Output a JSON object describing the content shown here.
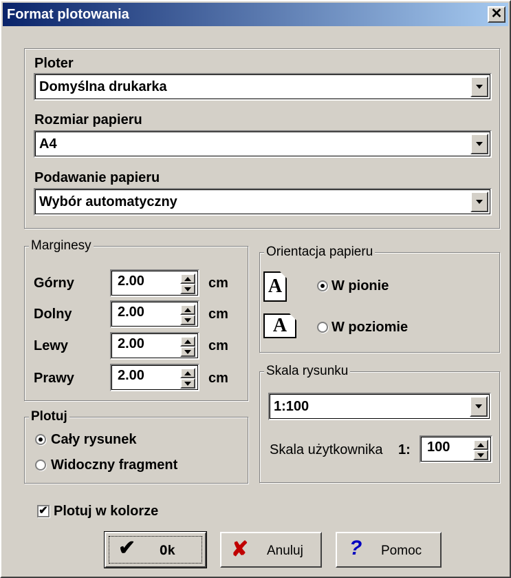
{
  "window": {
    "title": "Format plotowania",
    "close_label": "✕"
  },
  "plotter": {
    "ploter_label": "Ploter",
    "ploter_value": "Domyślna drukarka",
    "size_label": "Rozmiar papieru",
    "size_value": "A4",
    "feed_label": "Podawanie papieru",
    "feed_value": "Wybór automatyczny"
  },
  "margins": {
    "legend": "Marginesy",
    "unit": "cm",
    "rows": [
      {
        "label": "Górny",
        "value": "2.00"
      },
      {
        "label": "Dolny",
        "value": "2.00"
      },
      {
        "label": "Lewy",
        "value": "2.00"
      },
      {
        "label": "Prawy",
        "value": "2.00"
      }
    ]
  },
  "orientation": {
    "legend": "Orientacja papieru",
    "icon_letter": "A",
    "portrait_label": "W pionie",
    "landscape_label": "W poziomie",
    "selected": "portrait"
  },
  "scale": {
    "legend": "Skala rysunku",
    "value": "1:100",
    "user_label": "Skala użytkownika",
    "user_prefix": "1:",
    "user_value": "100"
  },
  "plot": {
    "legend": "Plotuj",
    "whole_label": "Cały rysunek",
    "visible_label": "Widoczny fragment",
    "selected": "whole"
  },
  "color": {
    "label": "Plotuj w kolorze",
    "checked": true,
    "check_glyph": "✔"
  },
  "buttons": {
    "ok": "Ok",
    "ok_icon": "✔",
    "cancel": "Anuluj",
    "cancel_icon": "✘",
    "help": "Pomoc",
    "help_icon": "?"
  },
  "colors": {
    "title_start": "#0a246a",
    "face": "#d4d0c8",
    "cancel_red": "#c00000",
    "help_blue": "#0000c0"
  }
}
